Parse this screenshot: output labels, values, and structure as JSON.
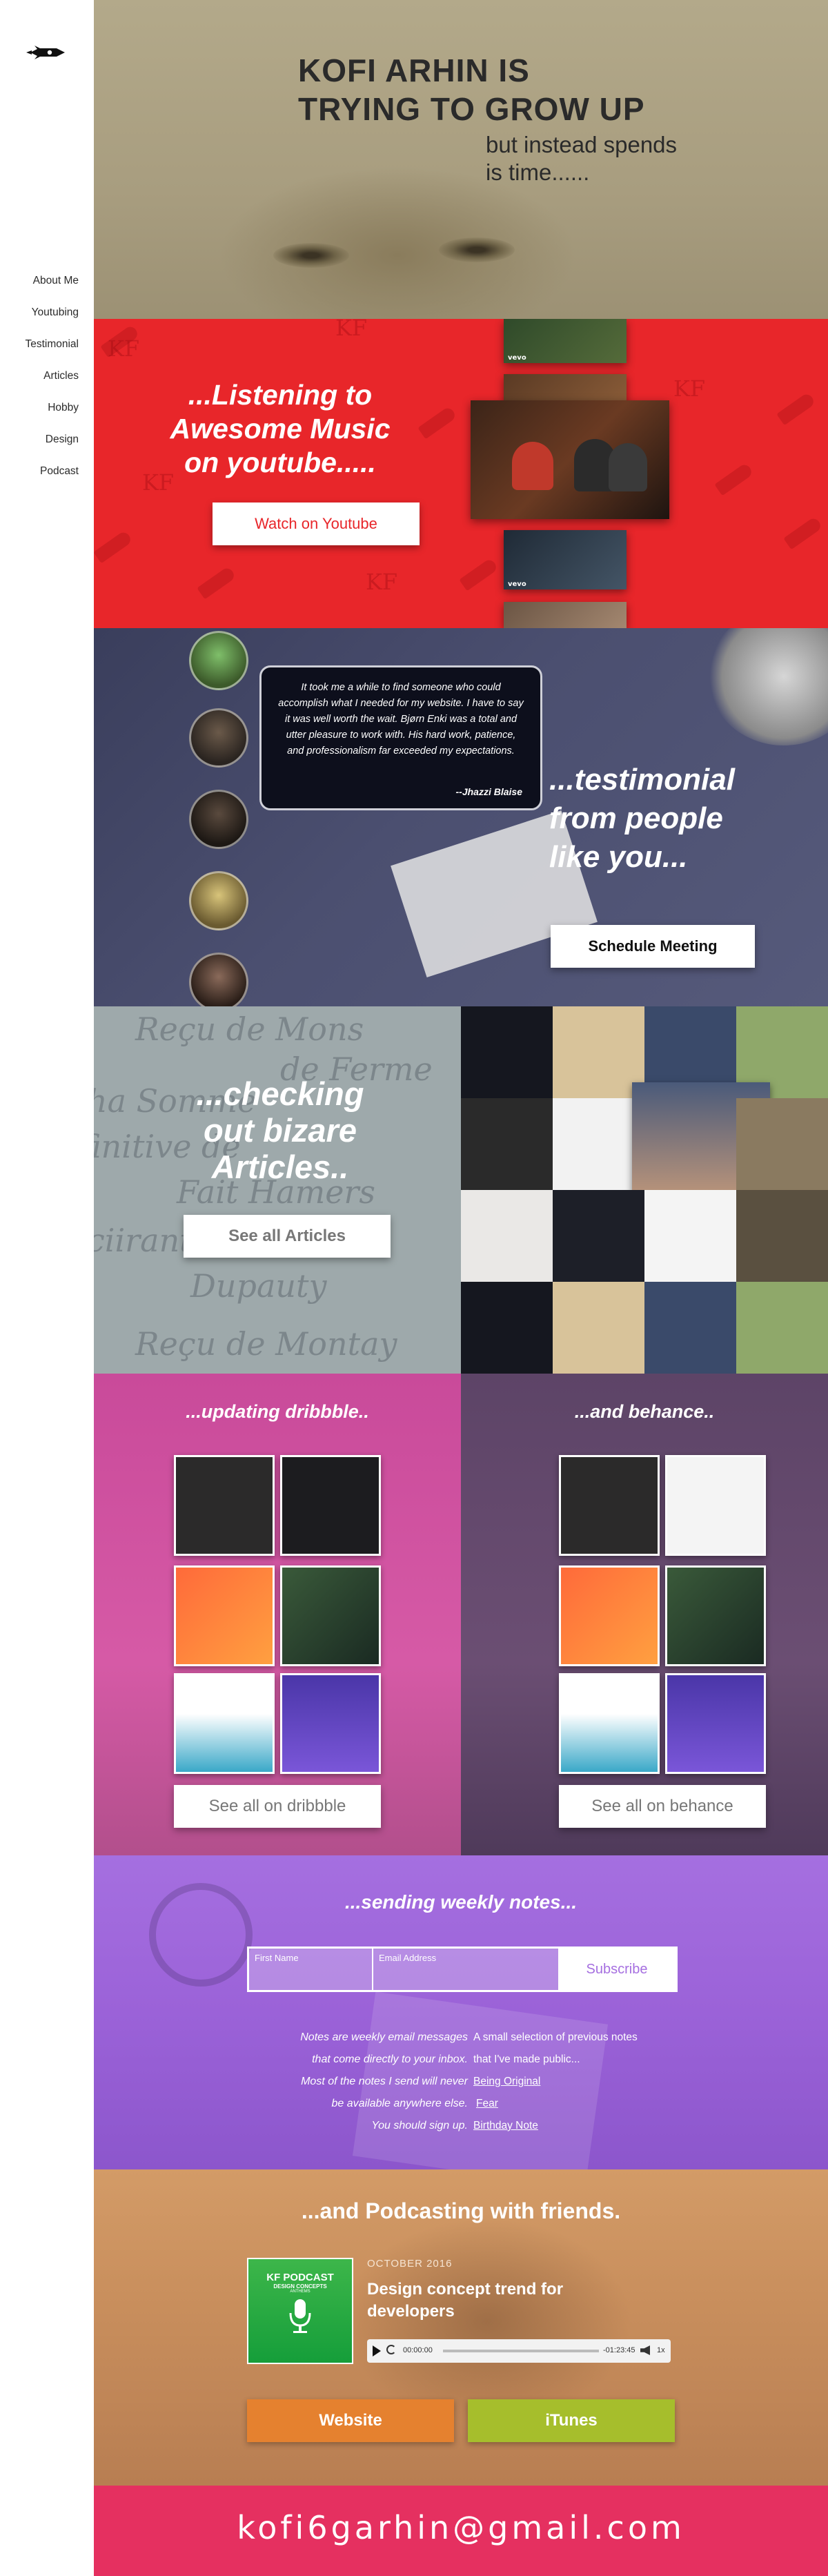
{
  "sidebar": {
    "logo_icon": "rocket-kf-logo-icon",
    "nav": [
      "About Me",
      "Youtubing",
      "Testimonial",
      "Articles",
      "Hobby",
      "Design",
      "Podcast"
    ]
  },
  "hero": {
    "title_line1": "KOFI ARHIN IS",
    "title_line2": "TRYING TO GROW UP",
    "sub_line1": "but instead spends",
    "sub_line2": "is time......"
  },
  "youtube": {
    "heading_line1": "...Listening to",
    "heading_line2": "Awesome Music",
    "heading_line3": "on youtube.....",
    "button": "Watch on Youtube",
    "watermark": "KF",
    "vevo": "vevo",
    "bg_color": "#e8262a"
  },
  "testimonial": {
    "quote": "It took me a while to find someone who could accomplish what I needed for my website. I have to say it was well worth the wait. Bjørn Enki was a total and utter pleasure to work with. His hard work, patience, and professionalism far exceeded my expectations.",
    "author": "--Jhazzi Blaise",
    "heading_line1": "...testimonial",
    "heading_line2": "from people",
    "heading_line3": "like you...",
    "button": "Schedule Meeting"
  },
  "articles": {
    "heading_line1": "...checking",
    "heading_line2": "out bizare",
    "heading_line3": "Articles..",
    "button": "See all Articles",
    "script_text": [
      "Reçu de Mons",
      "de Ferme",
      "ha Somme",
      "finitive de",
      "Fait Hamers",
      "Dupauty",
      "ciirant",
      "Reçu de Montay"
    ]
  },
  "work": {
    "dribbble_heading": "...updating dribbble..",
    "behance_heading": "...and behance..",
    "dribbble_button": "See all on dribbble",
    "behance_button": "See all on behance"
  },
  "notes": {
    "heading": "...sending weekly notes...",
    "first_name_placeholder": "First Name",
    "email_placeholder": "Email Address",
    "subscribe": "Subscribe",
    "left_text": [
      "Notes are weekly email messages",
      "that come directly to your inbox.",
      "Most of the notes I send will never",
      "be available anywhere else.",
      "You should sign up."
    ],
    "right_intro": [
      "A small selection of previous notes",
      "that I've made public..."
    ],
    "links": [
      "Being Original",
      "Fear",
      "Birthday Note"
    ]
  },
  "podcast": {
    "heading": "...and Podcasting with friends.",
    "cover_title": "KF PODCAST",
    "cover_sub": "DESIGN CONCEPTS",
    "cover_small": "ANTHEMS",
    "date": "OCTOBER 2016",
    "episode_title_line1": "Design concept trend for",
    "episode_title_line2": "developers",
    "time_current": "00:00:00",
    "time_total": "-01:23:45",
    "speed": "1x",
    "website_button": "Website",
    "itunes_button": "iTunes",
    "website_color": "#e5812f",
    "itunes_color": "#a6be2c"
  },
  "footer": {
    "email": "kofi6garhin@gmail.com",
    "bg_color": "#e53060"
  }
}
